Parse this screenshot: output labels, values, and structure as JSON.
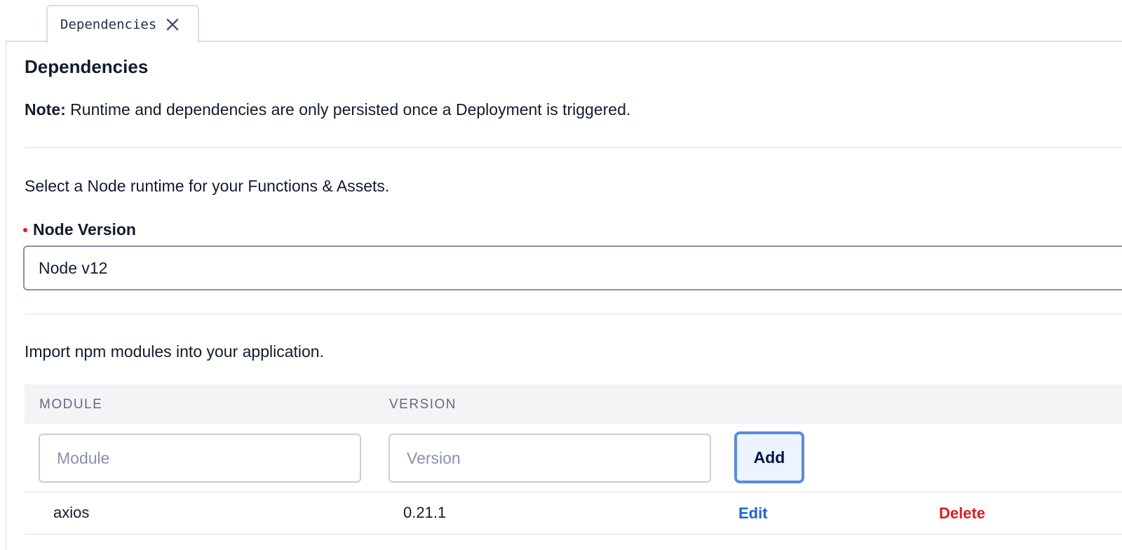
{
  "tab": {
    "label": "Dependencies",
    "close_icon": "close-icon"
  },
  "page": {
    "title": "Dependencies",
    "note_label": "Note:",
    "note_text": " Runtime and dependencies are only persisted once a Deployment is triggered.",
    "runtime_prompt": "Select a Node runtime for your Functions & Assets.",
    "node_version_label": "Node Version",
    "node_version_value": "Node v12",
    "import_prompt": "Import npm modules into your application."
  },
  "table": {
    "columns": [
      "MODULE",
      "VERSION"
    ],
    "module_placeholder": "Module",
    "version_placeholder": "Version",
    "add_label": "Add",
    "rows": [
      {
        "module": "axios",
        "version": "0.21.1",
        "edit_label": "Edit",
        "delete_label": "Delete"
      }
    ]
  },
  "colors": {
    "required": "#d61f1f",
    "link_blue": "#1f63d6",
    "destructive": "#d61f1f",
    "focus_ring": "#5a8bd8"
  }
}
